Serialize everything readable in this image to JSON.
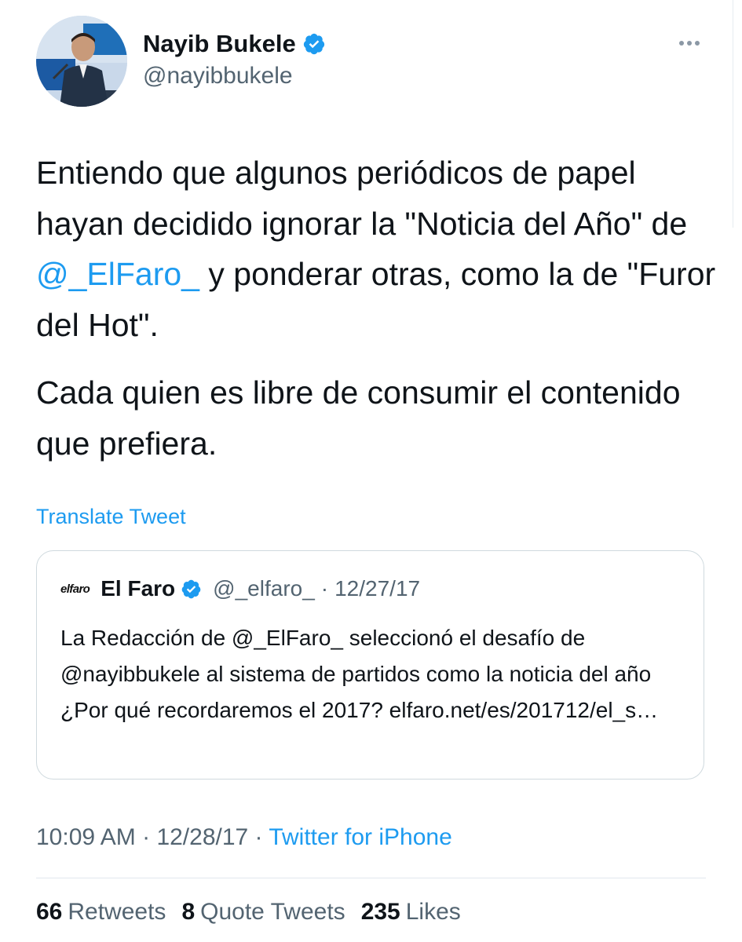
{
  "author": {
    "name": "Nayib Bukele",
    "handle": "@nayibbukele",
    "verified": true
  },
  "tweet": {
    "p1_a": "Entiendo que algunos periódicos de papel hayan decidido ignorar la \"Noticia del Año\" de ",
    "p1_mention": "@_ElFaro_",
    "p1_b": " y ponderar otras, como la de \"Furor del Hot\".",
    "p2": "Cada quien es libre de consumir el contenido que prefiera."
  },
  "translate_label": "Translate Tweet",
  "quote": {
    "logo_text": "elfaro",
    "name": "El Faro",
    "handle": "@_elfaro_",
    "separator": "·",
    "date": "12/27/17",
    "text": "La Redacción de @_ElFaro_ seleccionó el desafío de @nayibbukele  al sistema de partidos como la noticia del año ¿Por qué recordaremos el 2017? elfaro.net/es/201712/el_s…"
  },
  "meta": {
    "time": "10:09 AM",
    "separator": " · ",
    "date": "12/28/17",
    "source": "Twitter for iPhone"
  },
  "stats": {
    "retweets_count": "66",
    "retweets_label": "Retweets",
    "quotes_count": "8",
    "quotes_label": "Quote Tweets",
    "likes_count": "235",
    "likes_label": "Likes"
  },
  "colors": {
    "accent": "#1d9bf0",
    "secondary_text": "#536471",
    "primary_text": "#0f1419",
    "border": "#cfd9de"
  },
  "icons": {
    "verified": "verified-badge-icon",
    "more": "more-options-icon"
  }
}
